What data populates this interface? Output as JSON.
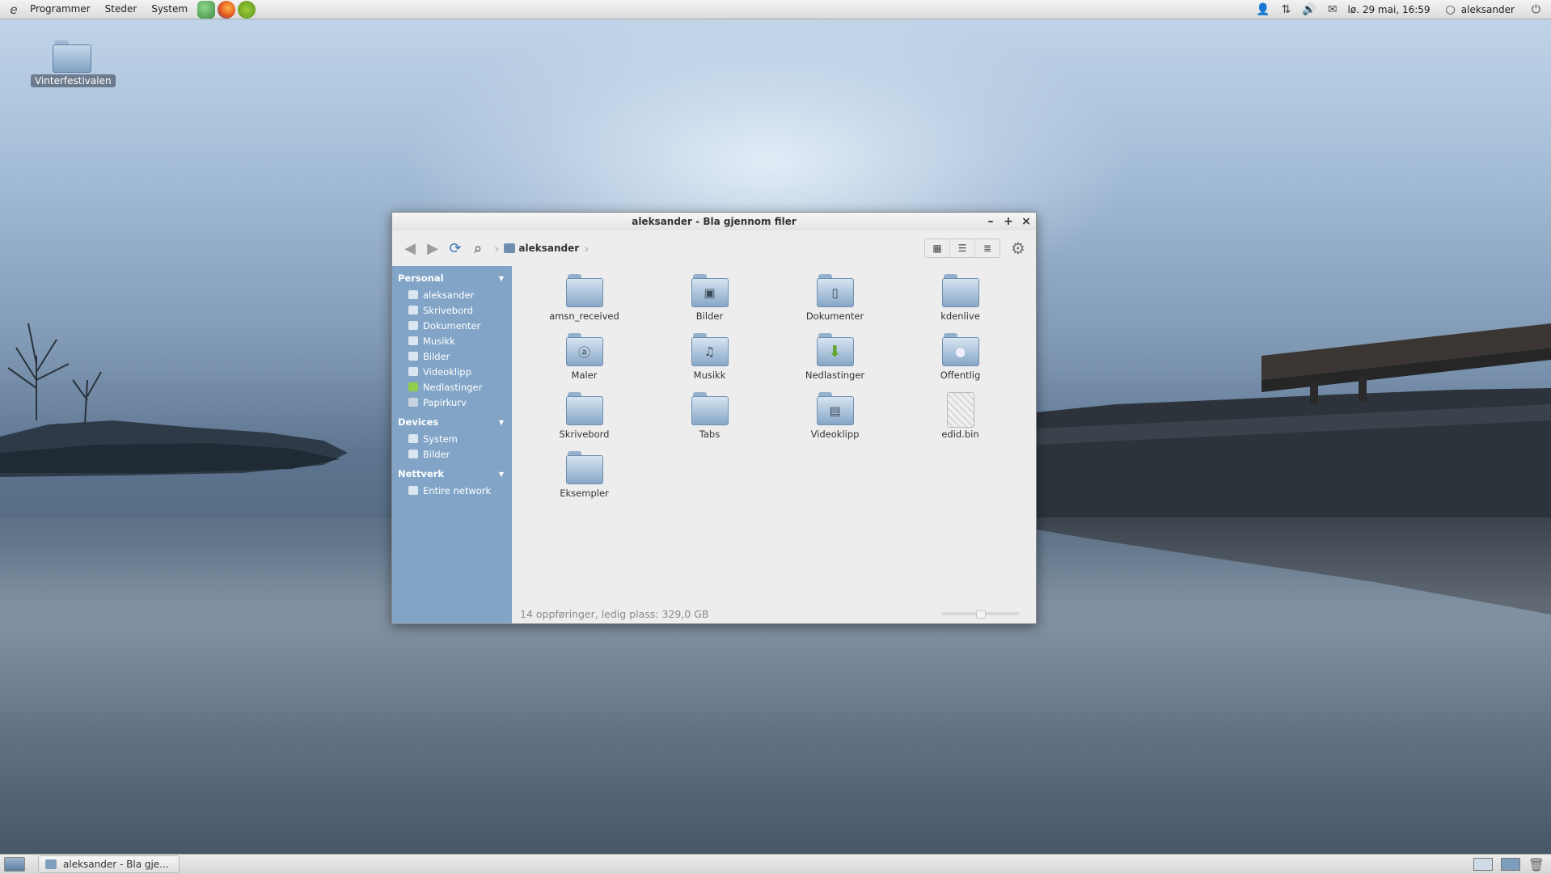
{
  "top_panel": {
    "menus": [
      "Programmer",
      "Steder",
      "System"
    ],
    "launchers": [
      "people-icon",
      "firefox-icon",
      "spotify-icon"
    ],
    "clock": "lø. 29 mai, 16:59",
    "user": "aleksander"
  },
  "desktop": {
    "icons": [
      {
        "label": "Vinterfestivalen"
      }
    ]
  },
  "window": {
    "title": "aleksander - Bla gjennom filer",
    "breadcrumb": "aleksander",
    "sidebar": {
      "personal_header": "Personal",
      "personal_items": [
        "aleksander",
        "Skrivebord",
        "Dokumenter",
        "Musikk",
        "Bilder",
        "Videoklipp",
        "Nedlastinger",
        "Papirkurv"
      ],
      "devices_header": "Devices",
      "devices_items": [
        "System",
        "Bilder"
      ],
      "network_header": "Nettverk",
      "network_items": [
        "Entire network"
      ]
    },
    "files": [
      {
        "name": "amsn_received",
        "kind": "folder"
      },
      {
        "name": "Bilder",
        "kind": "folder-pictures"
      },
      {
        "name": "Dokumenter",
        "kind": "folder-documents"
      },
      {
        "name": "kdenlive",
        "kind": "folder"
      },
      {
        "name": "Maler",
        "kind": "folder-templates"
      },
      {
        "name": "Musikk",
        "kind": "folder-music"
      },
      {
        "name": "Nedlastinger",
        "kind": "folder-download"
      },
      {
        "name": "Offentlig",
        "kind": "folder-public"
      },
      {
        "name": "Skrivebord",
        "kind": "folder"
      },
      {
        "name": "Tabs",
        "kind": "folder"
      },
      {
        "name": "Videoklipp",
        "kind": "folder-videos"
      },
      {
        "name": "edid.bin",
        "kind": "file"
      },
      {
        "name": "Eksempler",
        "kind": "folder"
      }
    ],
    "status": "14 oppføringer, ledig plass: 329,0 GB"
  },
  "taskbar": {
    "tasks": [
      "aleksander - Bla gje..."
    ]
  },
  "colors": {
    "sidebar_bg": "#82a5c7",
    "accent": "#3a79b8"
  }
}
